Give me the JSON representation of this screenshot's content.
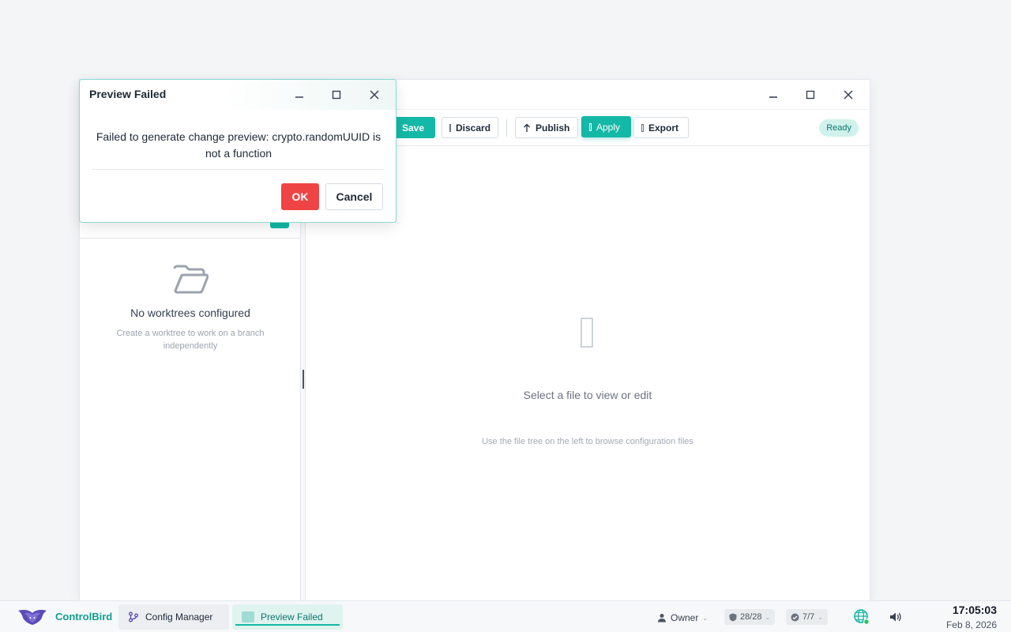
{
  "main_window": {
    "toolbar": {
      "save_label": "Save",
      "discard_label": "Discard",
      "publish_label": "Publish",
      "apply_label": "Apply",
      "export_label": "Export",
      "status": "Ready"
    },
    "worktrees": {
      "empty_title": "No worktrees configured",
      "empty_subtitle": "Create a worktree to work on a branch independently"
    },
    "editor": {
      "empty_title": "Select a file to view or edit",
      "empty_subtitle": "Use the file tree on the left to browse configuration files"
    }
  },
  "dialog": {
    "title": "Preview Failed",
    "message": "Failed to generate change preview: crypto.randomUUID is not a function",
    "ok_label": "OK",
    "cancel_label": "Cancel"
  },
  "taskbar": {
    "brand": "ControlBird",
    "tasks": [
      {
        "label": "Config Manager",
        "icon": "git-branch-icon"
      },
      {
        "label": "Preview Failed",
        "icon": "window-icon"
      }
    ],
    "user": "Owner",
    "shield_count": "28/28",
    "check_count": "7/7",
    "time": "17:05:03",
    "date": "Feb 8, 2026"
  },
  "colors": {
    "accent": "#14b8a6",
    "danger": "#ef4444",
    "brand": "#0f9f8e"
  }
}
